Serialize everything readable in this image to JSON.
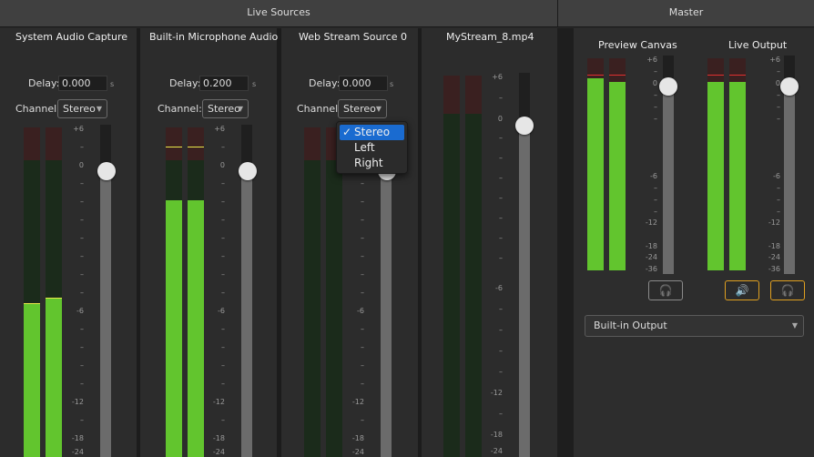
{
  "header": {
    "live_sources": "Live Sources",
    "master": "Master"
  },
  "channels": [
    {
      "title": "System Audio Capture",
      "delay_label": "Delay:",
      "delay": "0.000",
      "unit": "s",
      "channel_label": "Channel:",
      "channel": "Stereo",
      "meters": [
        {
          "level": 0.465,
          "peak": 0.465,
          "color": "#e8e84a"
        },
        {
          "level": 0.48,
          "peak": 0.48,
          "color": "#e8e84a"
        }
      ],
      "fader": 0.88
    },
    {
      "title": "Built-in Microphone Audio",
      "delay_label": "Delay:",
      "delay": "0.200",
      "unit": "s",
      "channel_label": "Channel:",
      "channel": "Stereo",
      "meters": [
        {
          "level": 0.78,
          "peak": 0.94,
          "color": "#e8e84a"
        },
        {
          "level": 0.78,
          "peak": 0.94,
          "color": "#e8e84a"
        }
      ],
      "fader": 0.88
    },
    {
      "title": "Web Stream Source 0",
      "delay_label": "Delay:",
      "delay": "0.000",
      "unit": "s",
      "channel_label": "Channel:",
      "channel": "Stereo",
      "meters": [
        {
          "level": 0,
          "peak": 0,
          "color": ""
        },
        {
          "level": 0,
          "peak": 0,
          "color": ""
        }
      ],
      "fader": 0.88
    },
    {
      "title": "MyStream_8.mp4",
      "meters": [
        {
          "level": 0,
          "peak": 0,
          "color": ""
        },
        {
          "level": 0,
          "peak": 0,
          "color": ""
        }
      ],
      "fader": 0.88
    }
  ],
  "ticks": [
    "+6",
    "–",
    "0",
    "–",
    "–",
    "–",
    "–",
    "–",
    "–",
    "–",
    "-6",
    "–",
    "–",
    "–",
    "–",
    "-12",
    "–",
    "-18",
    "-24",
    "-36"
  ],
  "channel_menu": {
    "options": [
      "Stereo",
      "Left",
      "Right"
    ],
    "selected": "Stereo",
    "check": "✓"
  },
  "master": {
    "preview": {
      "title": "Preview Canvas",
      "meters": [
        {
          "level": 0.905,
          "peak": 0.92,
          "color": "#e03030"
        },
        {
          "level": 0.89,
          "peak": 0.92,
          "color": "#e03030"
        }
      ],
      "fader": 0.85
    },
    "live": {
      "title": "Live Output",
      "meters": [
        {
          "level": 0.89,
          "peak": 0.92,
          "color": "#e03030"
        },
        {
          "level": 0.89,
          "peak": 0.92,
          "color": "#e03030"
        }
      ],
      "fader": 0.85
    },
    "ticks": [
      "+6",
      "–",
      "0",
      "–",
      "–",
      "–",
      "-6",
      "–",
      "–",
      "–",
      "-12",
      "-18",
      "-24",
      "-36"
    ],
    "output_device": "Built-in Output",
    "buttons": {
      "preview_headphones": "headphones-icon",
      "live_speaker": "speaker-icon",
      "live_headphones": "headphones-icon"
    }
  }
}
